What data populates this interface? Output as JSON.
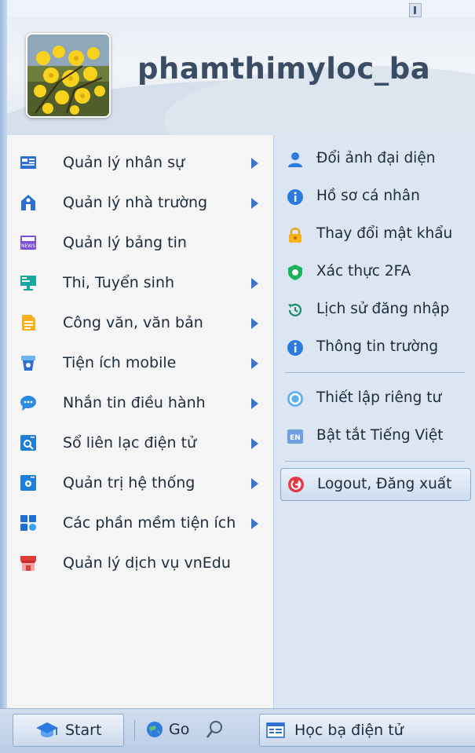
{
  "user": {
    "username": "phamthimyloc_ba"
  },
  "left_menu": [
    {
      "label": "Quản lý nhân sự",
      "icon": "staff-icon",
      "submenu": true
    },
    {
      "label": "Quản lý nhà trường",
      "icon": "school-icon",
      "submenu": true
    },
    {
      "label": "Quản lý bảng tin",
      "icon": "news-icon",
      "submenu": false
    },
    {
      "label": "Thi, Tuyển sinh",
      "icon": "exam-icon",
      "submenu": true
    },
    {
      "label": "Công văn, văn bản",
      "icon": "document-icon",
      "submenu": true
    },
    {
      "label": "Tiện ích mobile",
      "icon": "mobile-icon",
      "submenu": true
    },
    {
      "label": "Nhắn tin điều hành",
      "icon": "chat-icon",
      "submenu": true
    },
    {
      "label": "Sổ liên lạc điện tử",
      "icon": "contact-book-icon",
      "submenu": true
    },
    {
      "label": "Quản trị hệ thống",
      "icon": "system-admin-icon",
      "submenu": true
    },
    {
      "label": "Các phần mềm tiện ích",
      "icon": "apps-icon",
      "submenu": true
    },
    {
      "label": "Quản lý dịch vụ vnEdu",
      "icon": "service-store-icon",
      "submenu": false
    }
  ],
  "right_menu": {
    "group1": [
      {
        "label": "Đổi ảnh đại diện",
        "icon": "user-icon"
      },
      {
        "label": "Hồ sơ cá nhân",
        "icon": "info-icon"
      },
      {
        "label": "Thay đổi mật khẩu",
        "icon": "lock-icon"
      },
      {
        "label": "Xác thực 2FA",
        "icon": "shield-icon"
      },
      {
        "label": "Lịch sử đăng nhập",
        "icon": "history-icon"
      },
      {
        "label": "Thông tin trường",
        "icon": "info-icon"
      }
    ],
    "group2": [
      {
        "label": "Thiết lập riêng tư",
        "icon": "privacy-icon"
      },
      {
        "label": "Bật tắt Tiếng Việt",
        "icon": "language-icon",
        "badge": "EN"
      }
    ],
    "logout": {
      "label": "Logout, Đăng xuất",
      "icon": "logout-icon"
    }
  },
  "taskbar": {
    "start_label": "Start",
    "go_label": "Go",
    "app_label": "Học bạ điện tử"
  },
  "colors": {
    "accent_blue": "#3a76c8",
    "right_panel": "#dce6f3",
    "left_panel": "#f5f5f5",
    "username": "#3a4d64"
  }
}
